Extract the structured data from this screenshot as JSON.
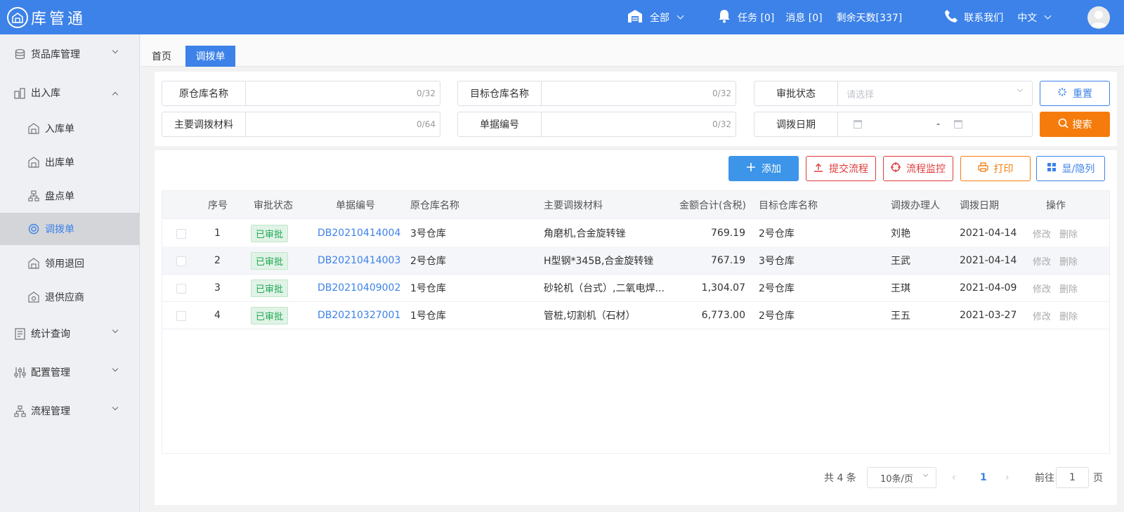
{
  "app": {
    "name": "库管通"
  },
  "topbar": {
    "scope": "全部",
    "tasks": "任务 [0]",
    "messages": "消息 [0]",
    "remaining": "剩余天数[337]",
    "contact": "联系我们",
    "language": "中文"
  },
  "sidebar": {
    "items": [
      {
        "label": "货品库管理",
        "icon": "database-icon"
      },
      {
        "label": "出入库",
        "icon": "inout-icon"
      },
      {
        "label": "统计查询",
        "icon": "report-icon"
      },
      {
        "label": "配置管理",
        "icon": "sliders-icon"
      },
      {
        "label": "流程管理",
        "icon": "flow-icon"
      }
    ],
    "sub_items": [
      {
        "label": "入库单",
        "icon": "warehouse-in-icon"
      },
      {
        "label": "出库单",
        "icon": "warehouse-out-icon"
      },
      {
        "label": "盘点单",
        "icon": "org-chart-icon"
      },
      {
        "label": "调拨单",
        "icon": "target-icon"
      },
      {
        "label": "领用退回",
        "icon": "return-icon"
      },
      {
        "label": "退供应商",
        "icon": "supplier-return-icon"
      }
    ]
  },
  "tabs": [
    {
      "label": "首页"
    },
    {
      "label": "调拨单"
    }
  ],
  "search": {
    "source_label": "原仓库名称",
    "source_count": "0/32",
    "target_label": "目标仓库名称",
    "target_count": "0/32",
    "status_label": "审批状态",
    "status_placeholder": "请选择",
    "material_label": "主要调拨材料",
    "material_count": "0/64",
    "docno_label": "单据编号",
    "docno_count": "0/32",
    "date_label": "调拨日期",
    "date_sep": "-",
    "reset_label": "重置",
    "search_label": "搜索"
  },
  "toolbar": {
    "add": "添加",
    "submit_flow": "提交流程",
    "monitor_flow": "流程监控",
    "print": "打印",
    "toggle_columns": "显/隐列"
  },
  "table": {
    "headers": [
      "序号",
      "审批状态",
      "单据编号",
      "原仓库名称",
      "主要调拨材料",
      "金额合计(含税)",
      "目标仓库名称",
      "调拨办理人",
      "调拨日期",
      "操作"
    ],
    "rows": [
      {
        "no": "1",
        "status": "已审批",
        "docno": "DB20210414004",
        "source": "3号仓库",
        "material": "角磨机,合金旋转锉",
        "amount": "769.19",
        "target": "2号仓库",
        "handler": "刘艳",
        "date": "2021-04-14",
        "edit": "修改",
        "delete": "删除"
      },
      {
        "no": "2",
        "status": "已审批",
        "docno": "DB20210414003",
        "source": "2号仓库",
        "material": "H型钢*345B,合金旋转锉",
        "amount": "767.19",
        "target": "3号仓库",
        "handler": "王武",
        "date": "2021-04-14",
        "edit": "修改",
        "delete": "删除"
      },
      {
        "no": "3",
        "status": "已审批",
        "docno": "DB20210409002",
        "source": "1号仓库",
        "material": "砂轮机（台式）,二氧电焊...",
        "amount": "1,304.07",
        "target": "2号仓库",
        "handler": "王琪",
        "date": "2021-04-09",
        "edit": "修改",
        "delete": "删除"
      },
      {
        "no": "4",
        "status": "已审批",
        "docno": "DB20210327001",
        "source": "1号仓库",
        "material": "管桩,切割机（石材）",
        "amount": "6,773.00",
        "target": "2号仓库",
        "handler": "王五",
        "date": "2021-03-27",
        "edit": "修改",
        "delete": "删除"
      }
    ]
  },
  "pagination": {
    "total": "共 4 条",
    "page_size": "10条/页",
    "current": "1",
    "goto_prefix": "前往",
    "goto_value": "1",
    "goto_suffix": "页"
  },
  "colors": {
    "primary": "#3c82e8",
    "orange": "#f57c0c",
    "red": "#e03a3a",
    "approved": "#1fa856"
  }
}
